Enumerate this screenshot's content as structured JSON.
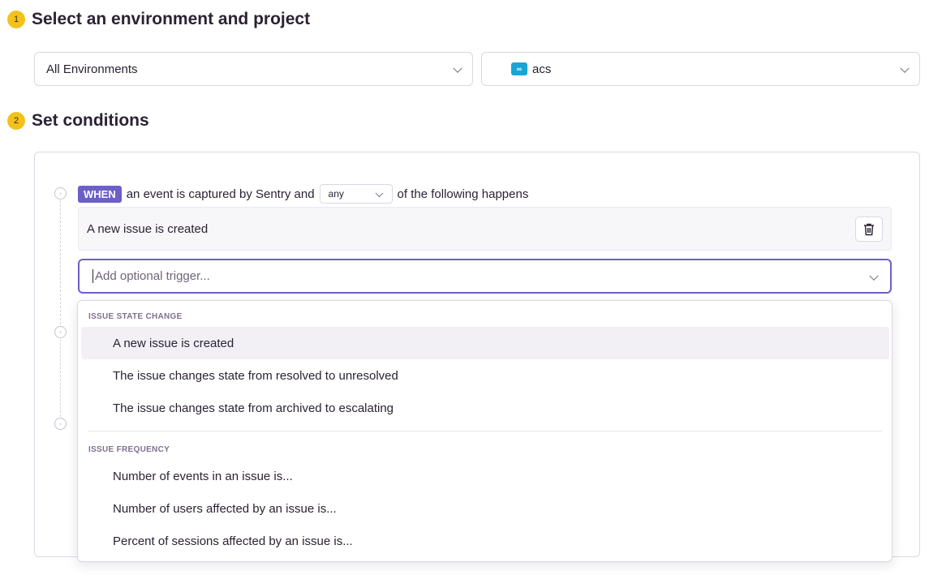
{
  "step1": {
    "number": "1",
    "title": "Select an environment and project"
  },
  "environment_select": {
    "value": "All Environments"
  },
  "project_select": {
    "value": "acs",
    "badge_icon": "infinity-icon"
  },
  "step2": {
    "number": "2",
    "title": "Set conditions"
  },
  "when_row": {
    "badge": "WHEN",
    "text_before": "an event is captured by Sentry and",
    "match_select": "any",
    "text_after": "of the following happens"
  },
  "trigger": {
    "label": "A new issue is created",
    "delete_icon": "trash-icon"
  },
  "trigger_input": {
    "placeholder": "Add optional trigger..."
  },
  "dropdown": {
    "groups": [
      {
        "header": "ISSUE STATE CHANGE",
        "options": [
          "A new issue is created",
          "The issue changes state from resolved to unresolved",
          "The issue changes state from archived to escalating"
        ]
      },
      {
        "header": "ISSUE FREQUENCY",
        "options": [
          "Number of events in an issue is...",
          "Number of users affected by an issue is...",
          "Percent of sessions affected by an issue is..."
        ]
      }
    ]
  },
  "colors": {
    "accent": "#6c5fc7",
    "step_badge": "#f2c21b",
    "project_badge": "#19a5d8"
  }
}
